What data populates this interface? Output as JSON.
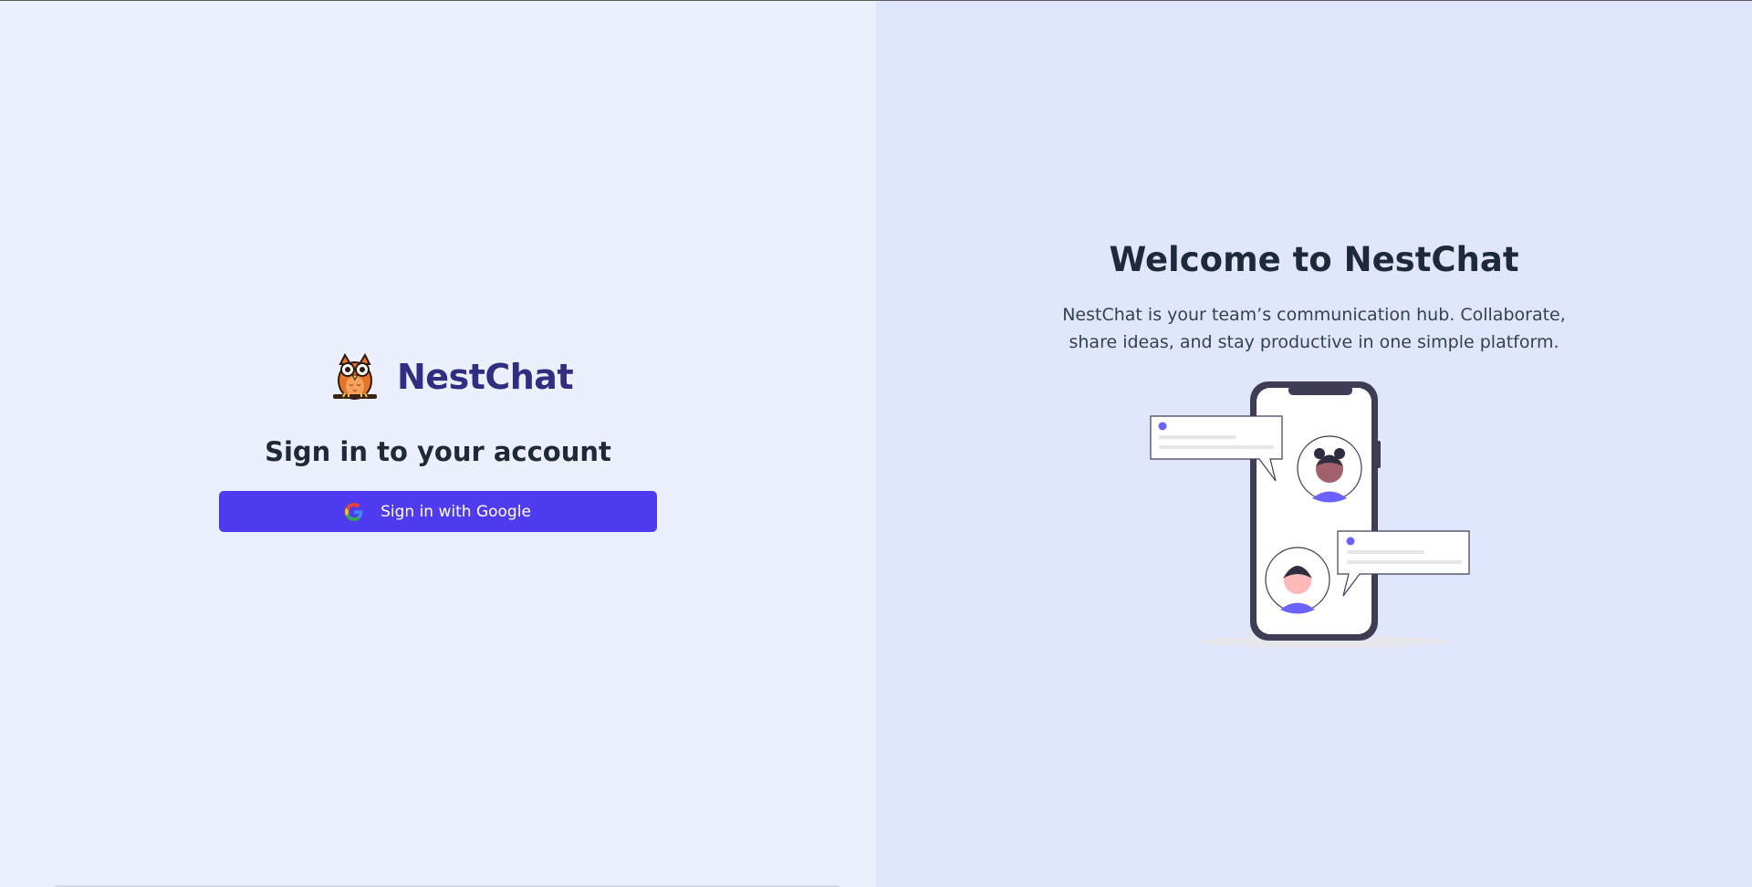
{
  "brand": {
    "name": "NestChat",
    "logo_icon": "owl-icon"
  },
  "signin": {
    "heading": "Sign in to your account",
    "google_button_label": "Sign in with Google",
    "google_icon": "google-icon"
  },
  "welcome": {
    "title": "Welcome to NestChat",
    "description": "NestChat is your team’s communication hub. Collaborate, share ideas, and stay productive in one simple platform."
  },
  "colors": {
    "left_background": "#ecf0fd",
    "right_background": "#e0e6fd",
    "brand_text": "#312e81",
    "button": "#4f3cf0",
    "accent": "#6c63ff"
  }
}
